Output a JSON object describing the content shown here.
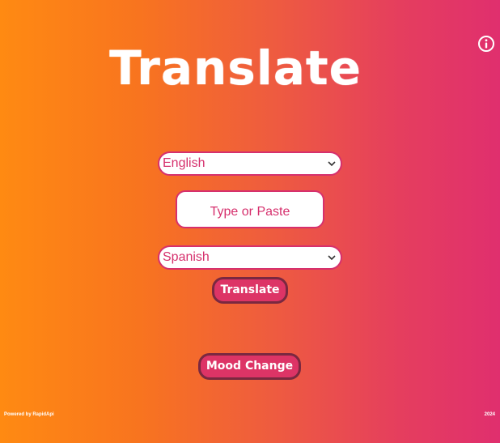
{
  "header": {
    "title": "Translate",
    "info_icon": "info-icon"
  },
  "from_language": {
    "selected": "English"
  },
  "input": {
    "placeholder": "Type or Paste"
  },
  "to_language": {
    "selected": "Spanish"
  },
  "buttons": {
    "translate_label": "Translate",
    "mood_change_label": "Mood Change"
  },
  "footer": {
    "powered_by": "Powered by RapidApi",
    "year": "2024"
  },
  "colors": {
    "accent": "#d6306d",
    "gradient_start": "#ff8a12",
    "gradient_end": "#e02f6e",
    "button_border": "#7a2840"
  }
}
